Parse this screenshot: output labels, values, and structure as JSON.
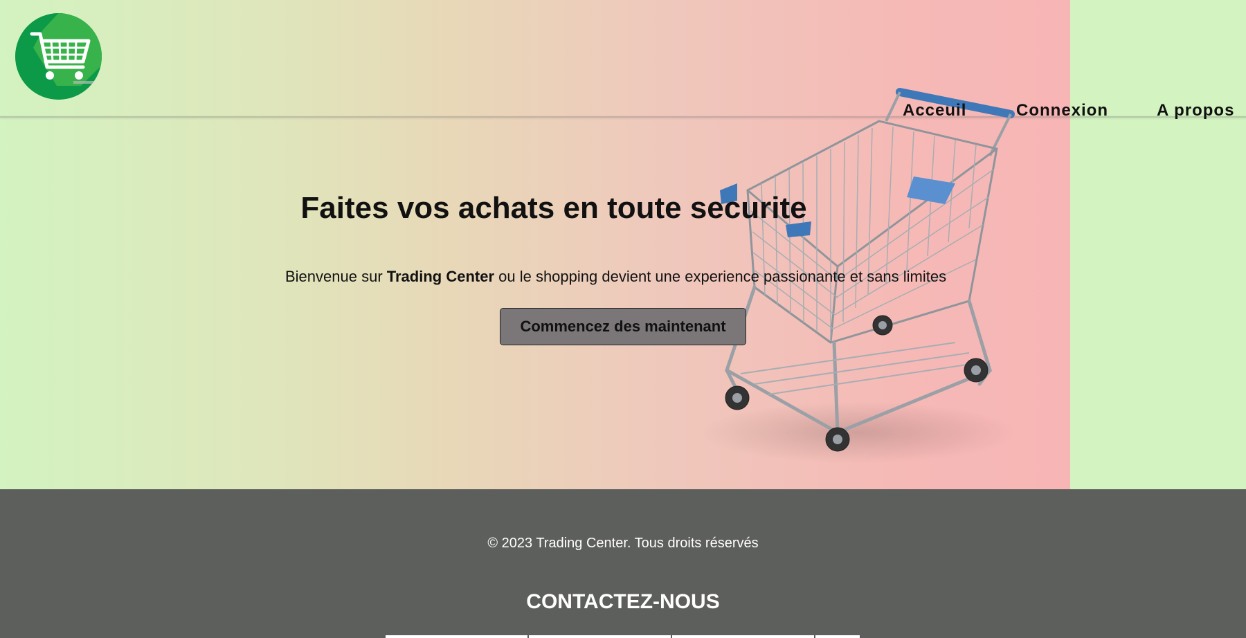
{
  "brand": {
    "logo_icon": "shopping-cart-icon",
    "colors": {
      "logo_green": "#0c9a48",
      "hero_green": "#d3f3c0",
      "hero_pink": "#f7b6b5",
      "footer_gray": "#5d5f5c",
      "button_gray": "#7b7678"
    }
  },
  "nav": {
    "items": [
      {
        "label": "Acceuil"
      },
      {
        "label": "Connexion"
      },
      {
        "label": "A propos"
      }
    ]
  },
  "hero": {
    "title": "Faites vos achats en toute securite",
    "subtitle_prefix": "Bienvenue sur ",
    "subtitle_brand": "Trading Center",
    "subtitle_suffix": " ou le shopping devient une experience passionante et sans limites",
    "cta_label": "Commencez des maintenant",
    "image_icon": "shopping-cart-photo"
  },
  "footer": {
    "copyright": "© 2023 Trading Center. Tous droits réservés",
    "contact_title": "CONTACTEZ-NOUS"
  }
}
